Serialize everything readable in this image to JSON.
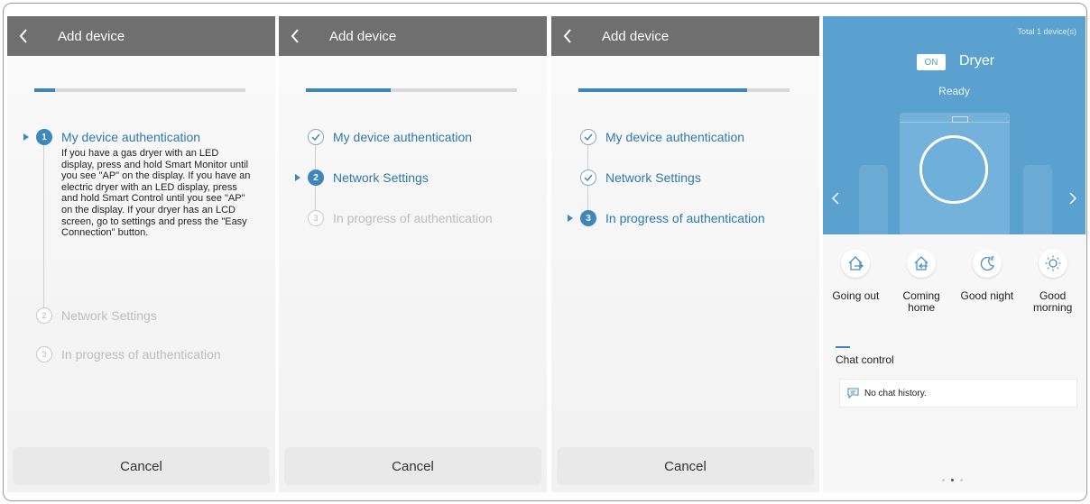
{
  "screens": [
    {
      "header_title": "Add device",
      "progress": 0.1,
      "steps": [
        {
          "number": "1",
          "label": "My device authentication",
          "state": "active"
        },
        {
          "number": "2",
          "label": "Network Settings",
          "state": "pending"
        },
        {
          "number": "3",
          "label": "In progress of authentication",
          "state": "pending"
        }
      ],
      "description": "If you have a gas dryer with an LED display, press and hold Smart Monitor until you see \"AP\" on the display. If you have an electric dryer with an LED display, press and hold Smart Control until you see \"AP\" on the display. If your dryer has an LCD screen, go to settings and press the \"Easy Connection\" button.",
      "cancel_label": "Cancel"
    },
    {
      "header_title": "Add device",
      "progress": 0.4,
      "steps": [
        {
          "number": "1",
          "label": "My device authentication",
          "state": "done"
        },
        {
          "number": "2",
          "label": "Network Settings",
          "state": "active"
        },
        {
          "number": "3",
          "label": "In progress of authentication",
          "state": "pending"
        }
      ],
      "cancel_label": "Cancel"
    },
    {
      "header_title": "Add device",
      "progress": 0.8,
      "steps": [
        {
          "number": "1",
          "label": "My device authentication",
          "state": "done"
        },
        {
          "number": "2",
          "label": "Network Settings",
          "state": "done"
        },
        {
          "number": "3",
          "label": "In progress of authentication",
          "state": "active"
        }
      ],
      "cancel_label": "Cancel"
    }
  ],
  "dryer": {
    "total_devices": "Total 1 device(s)",
    "power_badge": "ON",
    "name": "Dryer",
    "status": "Ready",
    "modes": [
      {
        "label": "Going out",
        "icon": "house-arrow-out-icon"
      },
      {
        "label": "Coming home",
        "icon": "house-arrow-in-icon"
      },
      {
        "label": "Good night",
        "icon": "moon-icon"
      },
      {
        "label": "Good morning",
        "icon": "sun-icon"
      }
    ],
    "chat_title": "Chat control",
    "chat_empty": "No chat history.",
    "page_indicator": {
      "count": 3,
      "current": 2
    }
  },
  "colors": {
    "accent": "#3d87bb",
    "header": "#6f6f6f",
    "hero": "#5aa1cf"
  }
}
